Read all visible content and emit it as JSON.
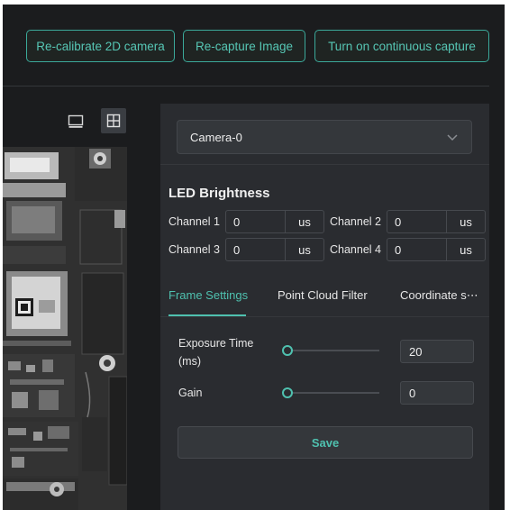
{
  "toolbar": {
    "recalibrate_label": "Re-calibrate 2D camera",
    "recapture_label": "Re-capture Image",
    "continuous_label": "Turn on continuous capture"
  },
  "view_modes": {
    "single_icon": "monitor-icon",
    "grid_icon": "grid-icon",
    "active": "grid"
  },
  "camera_select": {
    "value": "Camera-0",
    "icon": "chevron-down-icon"
  },
  "led": {
    "title": "LED Brightness",
    "channels": [
      {
        "label": "Channel 1",
        "value": "0",
        "unit": "us"
      },
      {
        "label": "Channel 2",
        "value": "0",
        "unit": "us"
      },
      {
        "label": "Channel 3",
        "value": "0",
        "unit": "us"
      },
      {
        "label": "Channel 4",
        "value": "0",
        "unit": "us"
      }
    ]
  },
  "tabs": [
    {
      "label": "Frame Settings",
      "active": true
    },
    {
      "label": "Point Cloud Filter",
      "active": false
    },
    {
      "label": "Coordinate s⋯",
      "active": false
    }
  ],
  "frame_settings": {
    "exposure": {
      "label_line1": "Exposure Time",
      "label_line2": "(ms)",
      "value": "20",
      "slider_level": 0
    },
    "gain": {
      "label": "Gain",
      "value": "0",
      "slider_level": 0
    }
  },
  "save_label": "Save",
  "colors": {
    "accent": "#4fc1af",
    "background": "#1b1c1e",
    "panel": "#2a2c30"
  }
}
